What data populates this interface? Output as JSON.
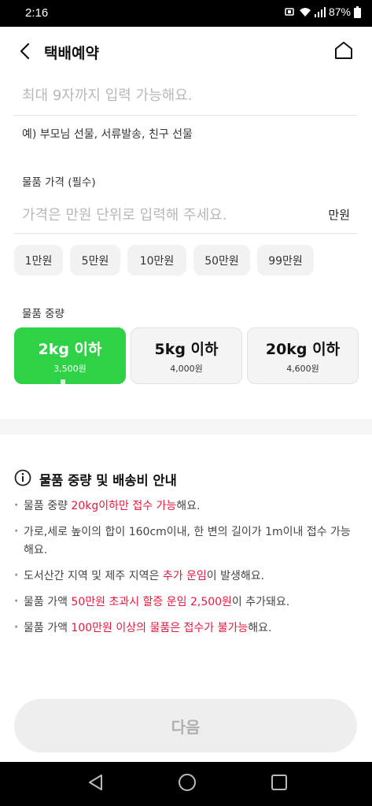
{
  "status_bar": {
    "time": "2:16",
    "battery": "87%",
    "icons": [
      "nfc-icon",
      "wifi-icon",
      "signal-icon",
      "battery-icon"
    ]
  },
  "header": {
    "title": "택배예약",
    "back_icon": "chevron-left-icon",
    "home_icon": "home-icon"
  },
  "item_name": {
    "value": "",
    "placeholder": "최대 9자까지 입력 가능해요.",
    "example": "예) 부모님 선물, 서류발송, 친구 선물"
  },
  "price": {
    "label": "물품 가격 (필수)",
    "value": "",
    "placeholder": "가격은 만원 단위로 입력해 주세요.",
    "unit": "만원",
    "quick_chips": [
      "1만원",
      "5만원",
      "10만원",
      "50만원",
      "99만원"
    ]
  },
  "weight": {
    "label": "물품 중량",
    "selected_index": 0,
    "options": [
      {
        "title": "2kg 이하",
        "price": "3,500원"
      },
      {
        "title": "5kg 이하",
        "price": "4,000원"
      },
      {
        "title": "20kg 이하",
        "price": "4,600원"
      }
    ]
  },
  "info": {
    "icon": "info-circle-icon",
    "title": "물품 중량 및 배송비 안내",
    "items": [
      {
        "pre": "물품 중량 ",
        "hl": "20kg이하만 접수 가능",
        "post": "해요."
      },
      {
        "pre": "가로,세로 높이의 합이 160cm이내, 한 변의 길이가 1m이내 접수 가능해요.",
        "hl": "",
        "post": ""
      },
      {
        "pre": "도서산간 지역 및 제주 지역은 ",
        "hl": "추가 운임",
        "post": "이 발생해요."
      },
      {
        "pre": "물품 가액 ",
        "hl": "50만원 초과시 할증 운임 2,500원",
        "post": "이 추가돼요."
      },
      {
        "pre": "물품 가액 ",
        "hl": "100만원 이상의 물품은 접수가 불가능",
        "post": "해요."
      }
    ]
  },
  "next_button": {
    "label": "다음",
    "enabled": false
  },
  "colors": {
    "accent": "#2fd247",
    "highlight": "#e8163d"
  },
  "nav_bar": {
    "icons": [
      "back-triangle-icon",
      "home-circle-icon",
      "recents-square-icon"
    ]
  }
}
